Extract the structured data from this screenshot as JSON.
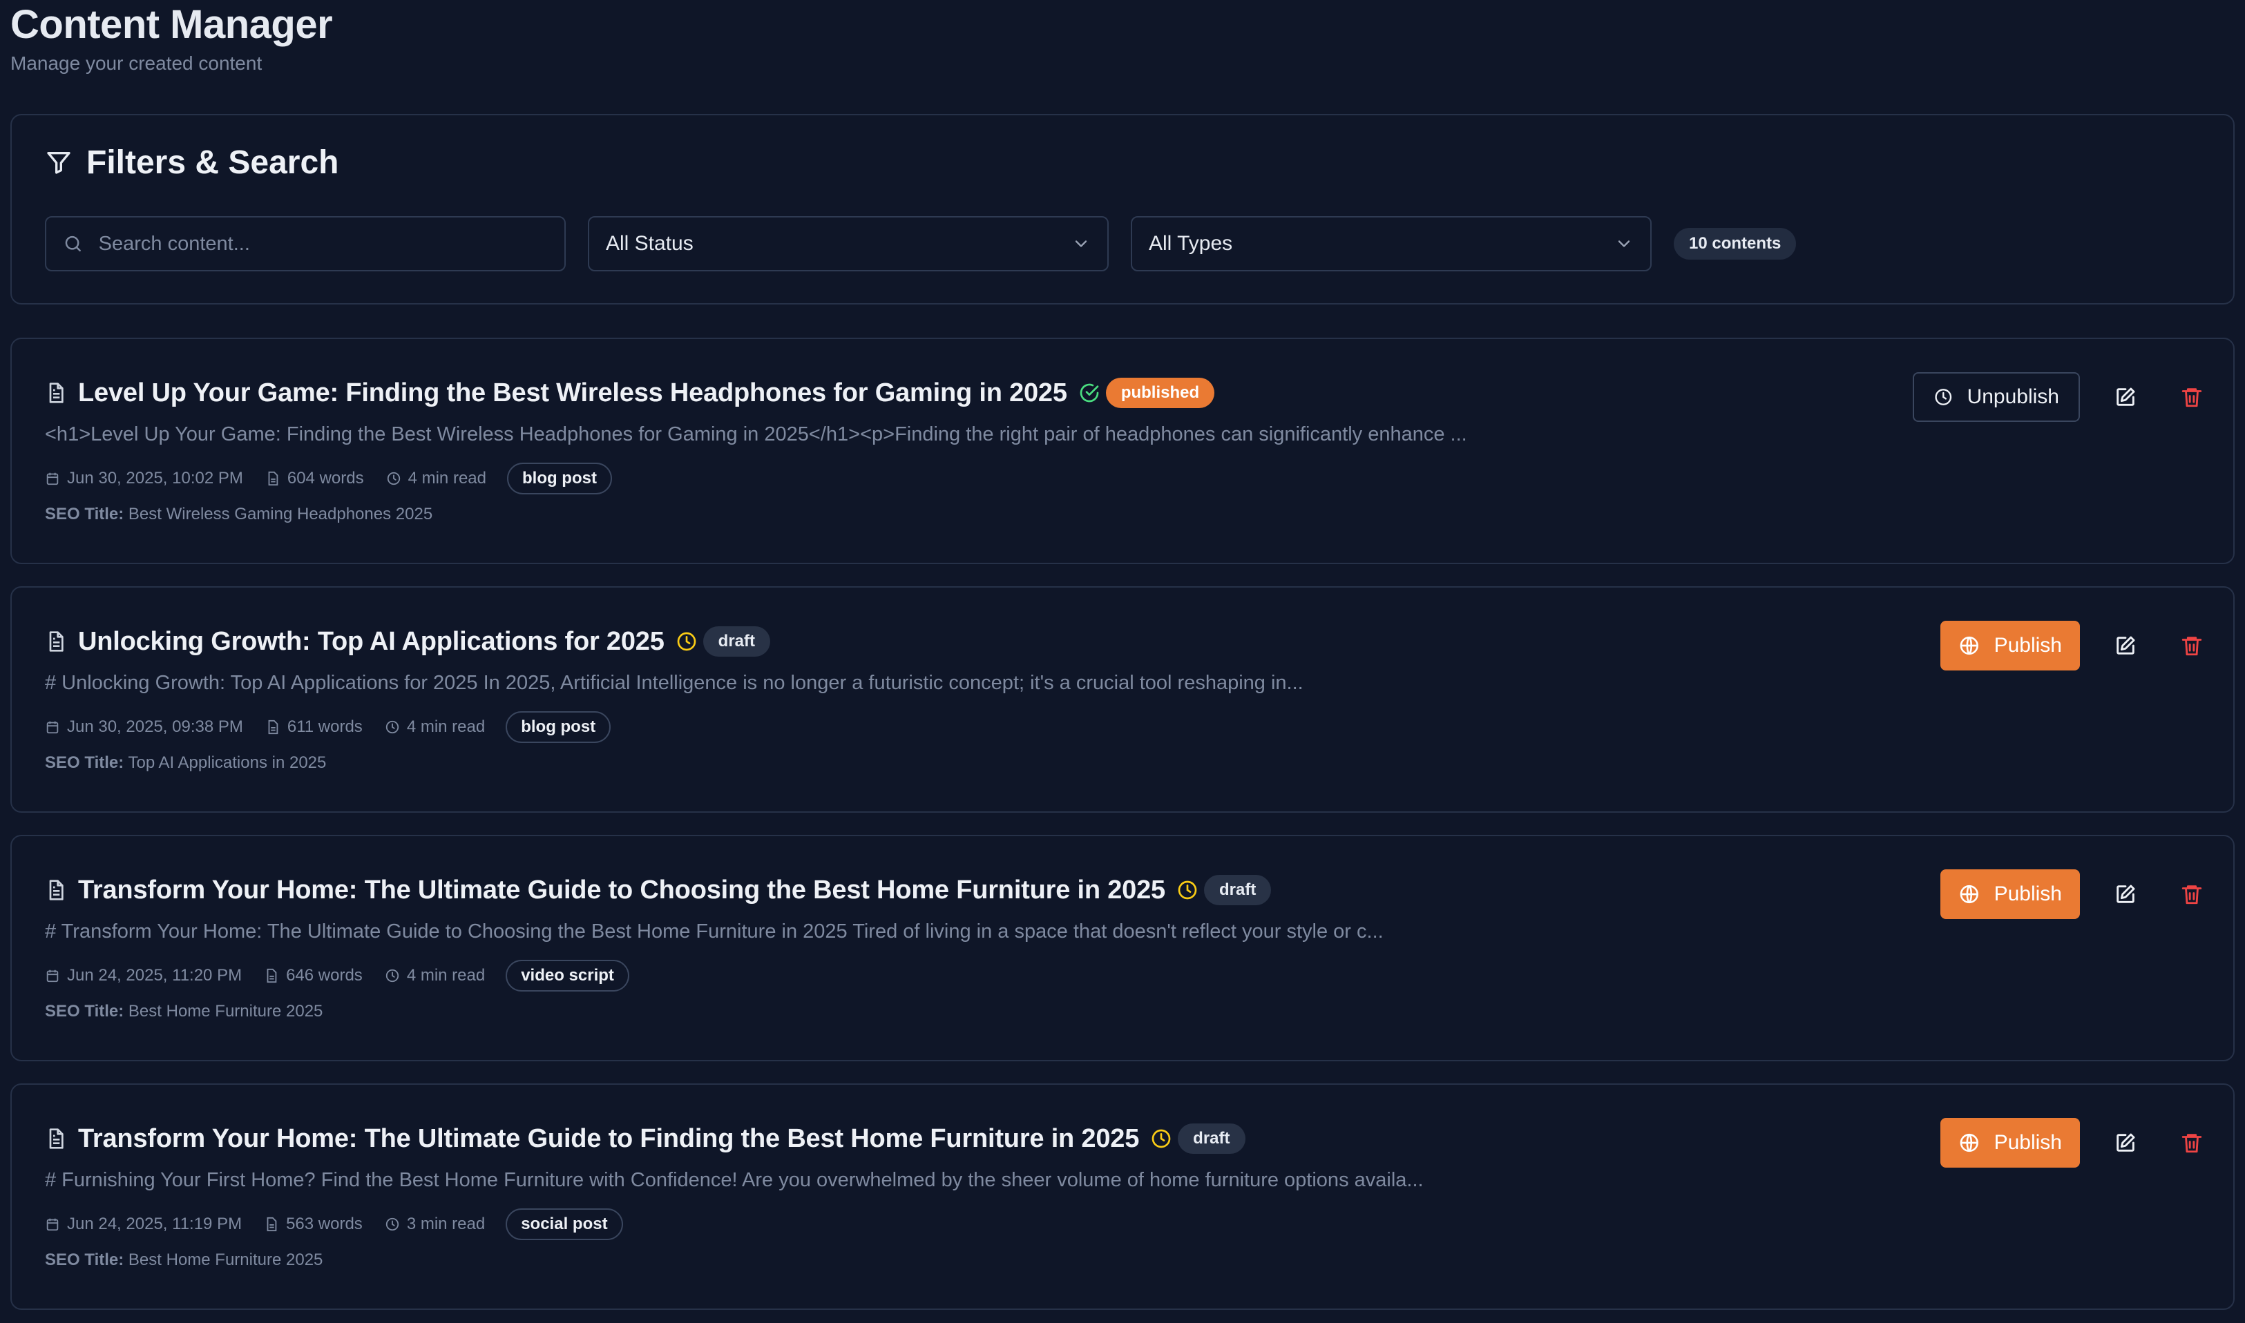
{
  "header": {
    "title": "Content Manager",
    "subtitle": "Manage your created content"
  },
  "filters": {
    "title": "Filters & Search",
    "search_placeholder": "Search content...",
    "status_select": "All Status",
    "type_select": "All Types",
    "count_label": "10 contents"
  },
  "colors": {
    "accent": "#ea7a33",
    "published_icon": "#4ade80",
    "draft_icon": "#facc15",
    "delete": "#ef4444"
  },
  "items": [
    {
      "title": "Level Up Your Game: Finding the Best Wireless Headphones for Gaming in 2025",
      "status": "published",
      "status_icon": "check-circle-icon",
      "excerpt": "<h1>Level Up Your Game: Finding the Best Wireless Headphones for Gaming in 2025</h1><p>Finding the right pair of headphones can significantly enhance ...",
      "date": "Jun 30, 2025, 10:02 PM",
      "words": "604 words",
      "read": "4 min read",
      "type": "blog post",
      "seo_label": "SEO Title:",
      "seo": "Best Wireless Gaming Headphones 2025",
      "action": "Unpublish",
      "action_icon": "clock-icon"
    },
    {
      "title": "Unlocking Growth: Top AI Applications for 2025",
      "status": "draft",
      "status_icon": "clock-icon",
      "excerpt": "# Unlocking Growth: Top AI Applications for 2025 In 2025, Artificial Intelligence is no longer a futuristic concept; it's a crucial tool reshaping in...",
      "date": "Jun 30, 2025, 09:38 PM",
      "words": "611 words",
      "read": "4 min read",
      "type": "blog post",
      "seo_label": "SEO Title:",
      "seo": "Top AI Applications in 2025",
      "action": "Publish",
      "action_icon": "globe-icon"
    },
    {
      "title": "Transform Your Home: The Ultimate Guide to Choosing the Best Home Furniture in 2025",
      "status": "draft",
      "status_icon": "clock-icon",
      "excerpt": "# Transform Your Home: The Ultimate Guide to Choosing the Best Home Furniture in 2025 Tired of living in a space that doesn't reflect your style or c...",
      "date": "Jun 24, 2025, 11:20 PM",
      "words": "646 words",
      "read": "4 min read",
      "type": "video script",
      "seo_label": "SEO Title:",
      "seo": "Best Home Furniture 2025",
      "action": "Publish",
      "action_icon": "globe-icon"
    },
    {
      "title": "Transform Your Home: The Ultimate Guide to Finding the Best Home Furniture in 2025",
      "status": "draft",
      "status_icon": "clock-icon",
      "excerpt": "# Furnishing Your First Home? Find the Best Home Furniture with Confidence! Are you overwhelmed by the sheer volume of home furniture options availa...",
      "date": "Jun 24, 2025, 11:19 PM",
      "words": "563 words",
      "read": "3 min read",
      "type": "social post",
      "seo_label": "SEO Title:",
      "seo": "Best Home Furniture 2025",
      "action": "Publish",
      "action_icon": "globe-icon"
    }
  ]
}
